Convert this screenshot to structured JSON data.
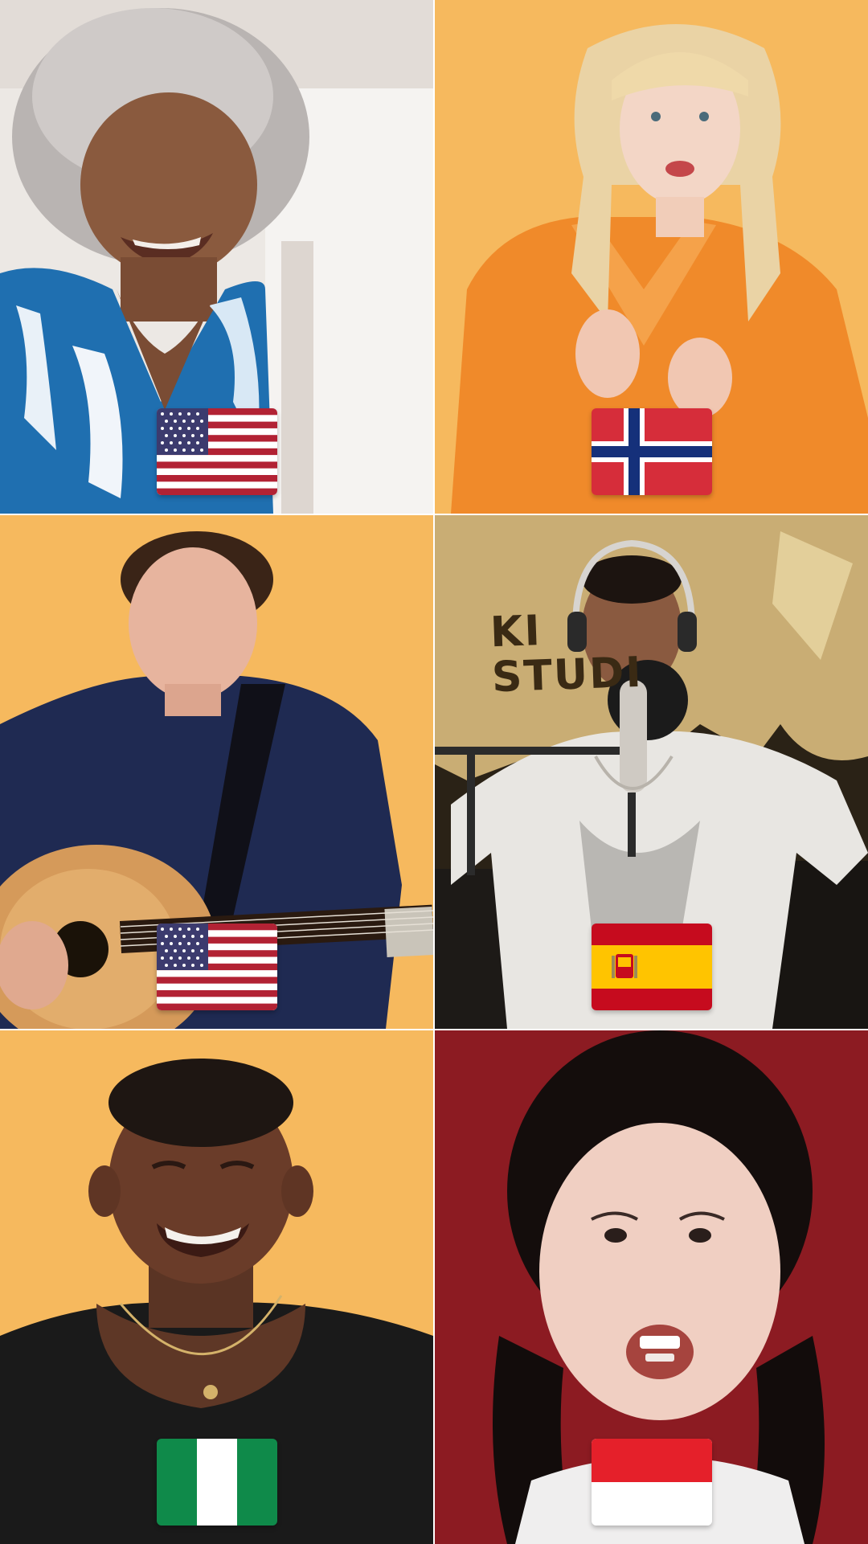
{
  "tiles": [
    {
      "id": "tile-1",
      "flag": "usa-flag",
      "background": "#e9e4df"
    },
    {
      "id": "tile-2",
      "flag": "norway-flag",
      "background": "#f6b95e"
    },
    {
      "id": "tile-3",
      "flag": "usa-flag",
      "background": "#f6b95e"
    },
    {
      "id": "tile-4",
      "flag": "spain-flag",
      "background": "#2b2418",
      "sign_text": "KI\nSTUDI"
    },
    {
      "id": "tile-5",
      "flag": "nigeria-flag",
      "background": "#f6b95e"
    },
    {
      "id": "tile-6",
      "flag": "indonesia-flag",
      "background": "#8c1b22"
    }
  ],
  "colors": {
    "mustard": "#f6b95e",
    "maroon": "#8c1b22",
    "usa_red": "#b22234",
    "usa_blue": "#3c3b6e",
    "norway_red": "#d62d3a",
    "norway_blue": "#15307a",
    "spain_red": "#c60b1e",
    "spain_yellow": "#ffc400",
    "nigeria_green": "#0f8a4a",
    "indonesia_red": "#e5202a"
  }
}
